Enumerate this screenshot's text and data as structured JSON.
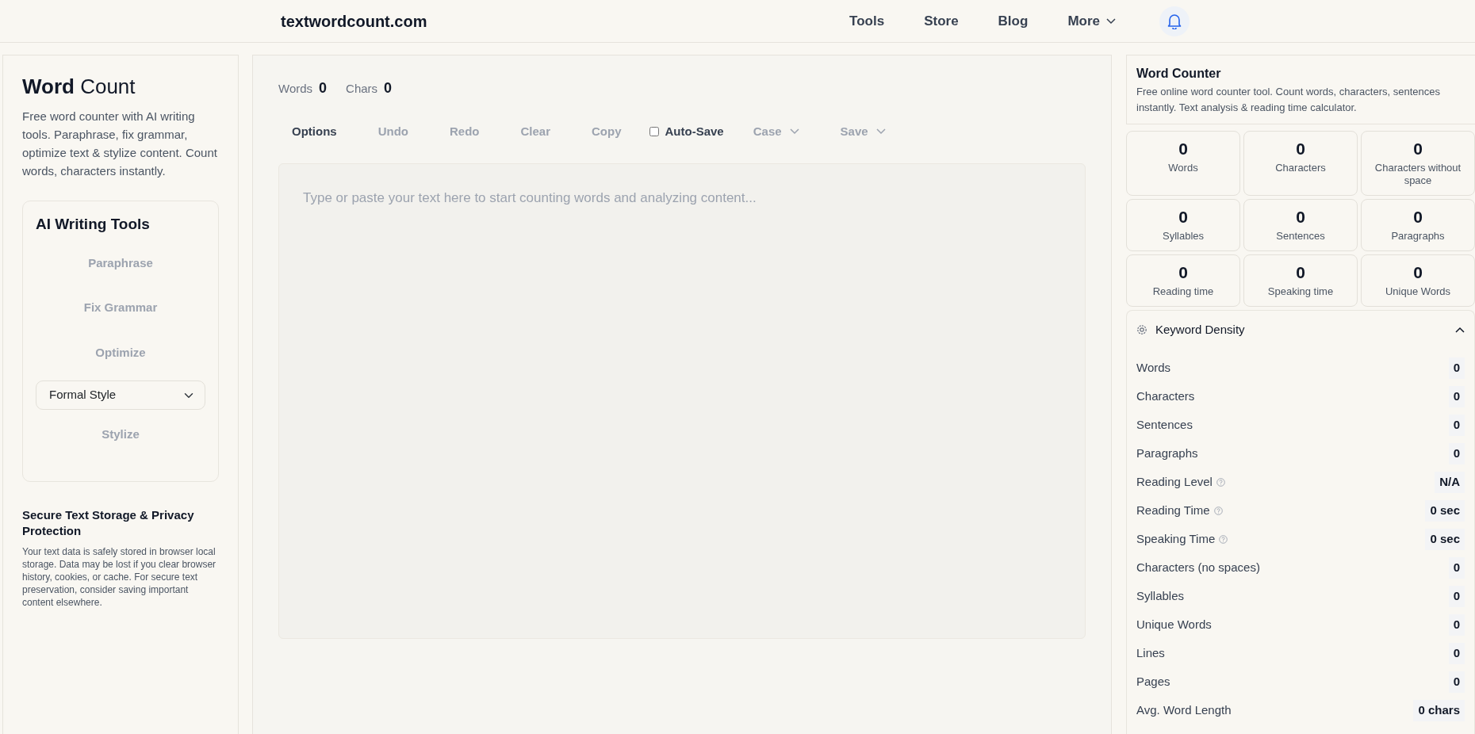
{
  "header": {
    "logo": "textwordcount.com",
    "nav": [
      {
        "label": "Tools",
        "kind": "link"
      },
      {
        "label": "Store",
        "kind": "link"
      },
      {
        "label": "Blog",
        "kind": "link"
      },
      {
        "label": "More",
        "kind": "dropdown"
      }
    ]
  },
  "sidebar": {
    "title": "**Word** Count",
    "description": "Free word counter with AI writing tools. Paraphrase, fix grammar, optimize text & stylize content. Count words, characters instantly.",
    "ai_tools": {
      "title": "AI Writing Tools",
      "items": [
        {
          "kind": "button",
          "label": "Paraphrase",
          "disabled": true
        },
        {
          "kind": "button",
          "label": "Fix Grammar",
          "disabled": true
        },
        {
          "kind": "button",
          "label": "Optimize",
          "disabled": true
        },
        {
          "kind": "select",
          "value": "Formal Style"
        },
        {
          "kind": "button",
          "label": "Stylize",
          "disabled": true
        }
      ]
    },
    "privacy": {
      "title": "Secure Text Storage & Privacy Protection",
      "text": "Your text data is safely stored in browser local storage. Data may be lost if you clear browser history, cookies, or cache. For secure text preservation, consider saving important content elsewhere."
    }
  },
  "editor": {
    "counts": [
      {
        "label": "Words",
        "value": "0"
      },
      {
        "label": "Chars",
        "value": "0"
      }
    ],
    "toolbar": [
      {
        "kind": "button",
        "label": "Options",
        "disabled": false
      },
      {
        "kind": "button",
        "label": "Undo",
        "disabled": true
      },
      {
        "kind": "button",
        "label": "Redo",
        "disabled": true
      },
      {
        "kind": "button",
        "label": "Clear",
        "disabled": true
      },
      {
        "kind": "button",
        "label": "Copy",
        "disabled": true
      },
      {
        "kind": "checkbox",
        "label": "Auto-Save",
        "checked": false
      },
      {
        "kind": "dropdown",
        "label": "Case",
        "disabled": true
      },
      {
        "kind": "dropdown",
        "label": "Save",
        "disabled": true
      }
    ],
    "placeholder": "Type or paste your text here to start counting words and analyzing content..."
  },
  "stats_panel": {
    "title": "Word Counter",
    "description": "Free online word counter tool. Count words, characters, sentences instantly. Text analysis & reading time calculator.",
    "tiles": [
      {
        "value": "0",
        "label": "Words"
      },
      {
        "value": "0",
        "label": "Characters"
      },
      {
        "value": "0",
        "label": "Characters without space"
      },
      {
        "value": "0",
        "label": "Syllables"
      },
      {
        "value": "0",
        "label": "Sentences"
      },
      {
        "value": "0",
        "label": "Paragraphs"
      },
      {
        "value": "0",
        "label": "Reading time"
      },
      {
        "value": "0",
        "label": "Speaking time"
      },
      {
        "value": "0",
        "label": "Unique Words"
      }
    ],
    "keyword_density": {
      "title": "Keyword Density",
      "expanded": true,
      "rows": [
        {
          "label": "Words",
          "value": "0",
          "help": false
        },
        {
          "label": "Characters",
          "value": "0",
          "help": false
        },
        {
          "label": "Sentences",
          "value": "0",
          "help": false
        },
        {
          "label": "Paragraphs",
          "value": "0",
          "help": false
        },
        {
          "label": "Reading Level",
          "value": "N/A",
          "help": true
        },
        {
          "label": "Reading Time",
          "value": "0 sec",
          "help": true
        },
        {
          "label": "Speaking Time",
          "value": "0 sec",
          "help": true
        },
        {
          "label": "Characters (no spaces)",
          "value": "0",
          "help": false
        },
        {
          "label": "Syllables",
          "value": "0",
          "help": false
        },
        {
          "label": "Unique Words",
          "value": "0",
          "help": false
        },
        {
          "label": "Lines",
          "value": "0",
          "help": false
        },
        {
          "label": "Pages",
          "value": "0",
          "help": false
        },
        {
          "label": "Avg. Word Length",
          "value": "0 chars",
          "help": false
        }
      ]
    }
  }
}
